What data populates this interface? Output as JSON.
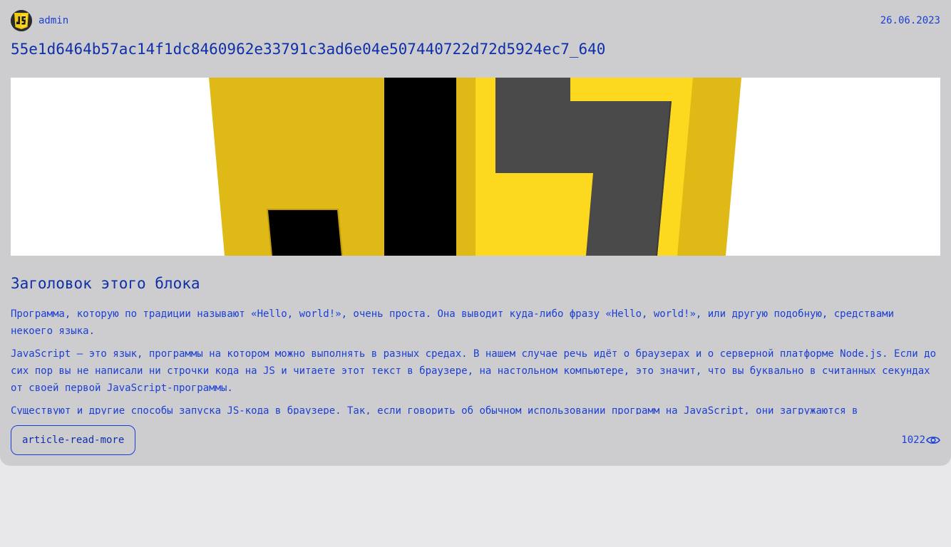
{
  "post": {
    "author": "admin",
    "date": "26.06.2023",
    "title": "55e1d6464b57ac14f1dc8460962e33791c3ad6e04e507440722d72d5924ec7_640",
    "heading": "Заголовок этого блока",
    "paragraphs": [
      "Программа, которую по традиции называют «Hello, world!», очень проста. Она выводит куда-либо фразу «Hello, world!», или другую подобную, средствами некоего языка.",
      "JavaScript — это язык, программы на котором можно выполнять в разных средах. В нашем случае речь идёт о браузерах и о серверной платформе Node.js. Если до сих пор вы не написали ни строчки кода на JS и читаете этот текст в браузере, на настольном компьютере, это значит, что вы буквально в считанных секундах от своей первой JavaScript-программы.",
      "Существуют и другие способы запуска JS-кода в браузере. Так, если говорить об обычном использовании программ на JavaScript, они загружаются в"
    ],
    "read_more_label": "article-read-more",
    "views": "1022"
  },
  "icons": {
    "avatar": "js-logo-icon",
    "views": "eye-icon"
  },
  "colors": {
    "card_bg": "#cdcdd0",
    "page_bg": "#e8e8ea",
    "text_blue": "#1a3fd6",
    "title_blue": "#0f2fa8",
    "js_yellow": "#f7d61e",
    "js_dark": "#4a4a4a"
  }
}
